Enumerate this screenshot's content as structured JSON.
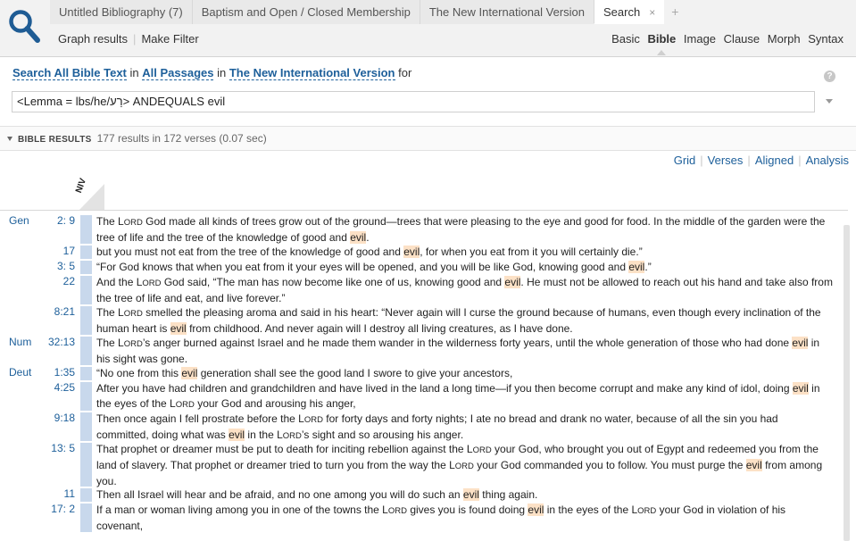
{
  "tabs": [
    {
      "label": "Untitled Bibliography (7)",
      "active": false
    },
    {
      "label": "Baptism and Open / Closed Membership",
      "active": false
    },
    {
      "label": "The New International Version",
      "active": false
    },
    {
      "label": "Search",
      "active": true
    }
  ],
  "tab_close": "×",
  "tab_add": "+",
  "toolbar": {
    "graph_results": "Graph results",
    "separator": "|",
    "make_filter": "Make Filter"
  },
  "modes": [
    "Basic",
    "Bible",
    "Image",
    "Clause",
    "Morph",
    "Syntax"
  ],
  "selected_mode": "Bible",
  "query": {
    "search_all": "Search All Bible Text",
    "in1": "in",
    "all_passages": "All Passages",
    "in2": "in",
    "version": "The New International Version",
    "for": "for",
    "value": "<Lemma = lbs/he/רַע> ANDEQUALS evil",
    "help": "?"
  },
  "results_header": {
    "label": "BIBLE RESULTS",
    "count": "177 results in 172 verses (0.07 sec)"
  },
  "views": [
    "Grid",
    "Verses",
    "Aligned",
    "Analysis"
  ],
  "views_separator": "|",
  "column_label": "NIV",
  "verses": [
    {
      "book": "Gen",
      "ref": "2: 9",
      "lines": [
        [
          {
            "t": "The L"
          },
          {
            "t": "ORD",
            "sc": 1
          },
          {
            "t": " God made all kinds of trees grow out of the ground—trees that were pleasing to the eye and good for food. In the middle of the garden were the"
          }
        ],
        [
          {
            "t": "tree of life and the tree of the knowledge of good and "
          },
          {
            "t": "evil",
            "hit": 1
          },
          {
            "t": "."
          }
        ]
      ]
    },
    {
      "book": "",
      "ref": "17",
      "lines": [
        [
          {
            "t": "but you must not eat from the tree of the knowledge of good and "
          },
          {
            "t": "evil",
            "hit": 1
          },
          {
            "t": ", for when you eat from it you will certainly die.”"
          }
        ]
      ]
    },
    {
      "book": "",
      "ref": "3: 5",
      "lines": [
        [
          {
            "t": "“For God knows that when you eat from it your eyes will be opened, and you will be like God, knowing good and "
          },
          {
            "t": "evil",
            "hit": 1
          },
          {
            "t": ".”"
          }
        ]
      ]
    },
    {
      "book": "",
      "ref": "22",
      "lines": [
        [
          {
            "t": "And the L"
          },
          {
            "t": "ORD",
            "sc": 1
          },
          {
            "t": " God said, “The man has now become like one of us, knowing good and "
          },
          {
            "t": "evil",
            "hit": 1
          },
          {
            "t": ". He must not be allowed to reach out his hand and take also from"
          }
        ],
        [
          {
            "t": "the tree of life and eat, and live forever.”"
          }
        ]
      ]
    },
    {
      "book": "",
      "ref": "8:21",
      "lines": [
        [
          {
            "t": "The L"
          },
          {
            "t": "ORD",
            "sc": 1
          },
          {
            "t": " smelled the pleasing aroma and said in his heart: “Never again will I curse the ground because of humans, even though every inclination of the"
          }
        ],
        [
          {
            "t": "human heart is "
          },
          {
            "t": "evil",
            "hit": 1
          },
          {
            "t": " from childhood. And never again will I destroy all living creatures, as I have done."
          }
        ]
      ]
    },
    {
      "book": "Num",
      "ref": "32:13",
      "lines": [
        [
          {
            "t": "The L"
          },
          {
            "t": "ORD",
            "sc": 1
          },
          {
            "t": "’s anger burned against Israel and he made them wander in the wilderness forty years, until the whole generation of those who had done "
          },
          {
            "t": "evil",
            "hit": 1
          },
          {
            "t": " in"
          }
        ],
        [
          {
            "t": "his sight was gone."
          }
        ]
      ]
    },
    {
      "book": "Deut",
      "ref": "1:35",
      "lines": [
        [
          {
            "t": "“No one from this "
          },
          {
            "t": "evil",
            "hit": 1
          },
          {
            "t": " generation shall see the good land I swore to give your ancestors,"
          }
        ]
      ]
    },
    {
      "book": "",
      "ref": "4:25",
      "lines": [
        [
          {
            "t": "After you have had children and grandchildren and have lived in the land a long time—if you then become corrupt and make any kind of idol, doing "
          },
          {
            "t": "evil",
            "hit": 1
          },
          {
            "t": " in"
          }
        ],
        [
          {
            "t": "the eyes of the L"
          },
          {
            "t": "ORD",
            "sc": 1
          },
          {
            "t": " your God and arousing his anger,"
          }
        ]
      ]
    },
    {
      "book": "",
      "ref": "9:18",
      "lines": [
        [
          {
            "t": "Then once again I fell prostrate before the L"
          },
          {
            "t": "ORD",
            "sc": 1
          },
          {
            "t": " for forty days and forty nights; I ate no bread and drank no water, because of all the sin you had"
          }
        ],
        [
          {
            "t": "committed, doing what was "
          },
          {
            "t": "evil",
            "hit": 1
          },
          {
            "t": " in the L"
          },
          {
            "t": "ORD",
            "sc": 1
          },
          {
            "t": "’s sight and so arousing his anger."
          }
        ]
      ]
    },
    {
      "book": "",
      "ref": "13: 5",
      "lines": [
        [
          {
            "t": "That prophet or dreamer must be put to death for inciting rebellion against the L"
          },
          {
            "t": "ORD",
            "sc": 1
          },
          {
            "t": " your God, who brought you out of Egypt and redeemed you from the"
          }
        ],
        [
          {
            "t": "land of slavery. That prophet or dreamer tried to turn you from the way the L"
          },
          {
            "t": "ORD",
            "sc": 1
          },
          {
            "t": " your God commanded you to follow. You must purge the "
          },
          {
            "t": "evil",
            "hit": 1
          },
          {
            "t": " from among"
          }
        ],
        [
          {
            "t": "you."
          }
        ]
      ]
    },
    {
      "book": "",
      "ref": "11",
      "lines": [
        [
          {
            "t": "Then all Israel will hear and be afraid, and no one among you will do such an "
          },
          {
            "t": "evil",
            "hit": 1
          },
          {
            "t": " thing again."
          }
        ]
      ]
    },
    {
      "book": "",
      "ref": "17: 2",
      "lines": [
        [
          {
            "t": "If a man or woman living among you in one of the towns the L"
          },
          {
            "t": "ORD",
            "sc": 1
          },
          {
            "t": " gives you is found doing "
          },
          {
            "t": "evil",
            "hit": 1
          },
          {
            "t": " in the eyes of the L"
          },
          {
            "t": "ORD",
            "sc": 1
          },
          {
            "t": " your God in violation of his"
          }
        ],
        [
          {
            "t": "covenant,"
          }
        ]
      ]
    }
  ]
}
